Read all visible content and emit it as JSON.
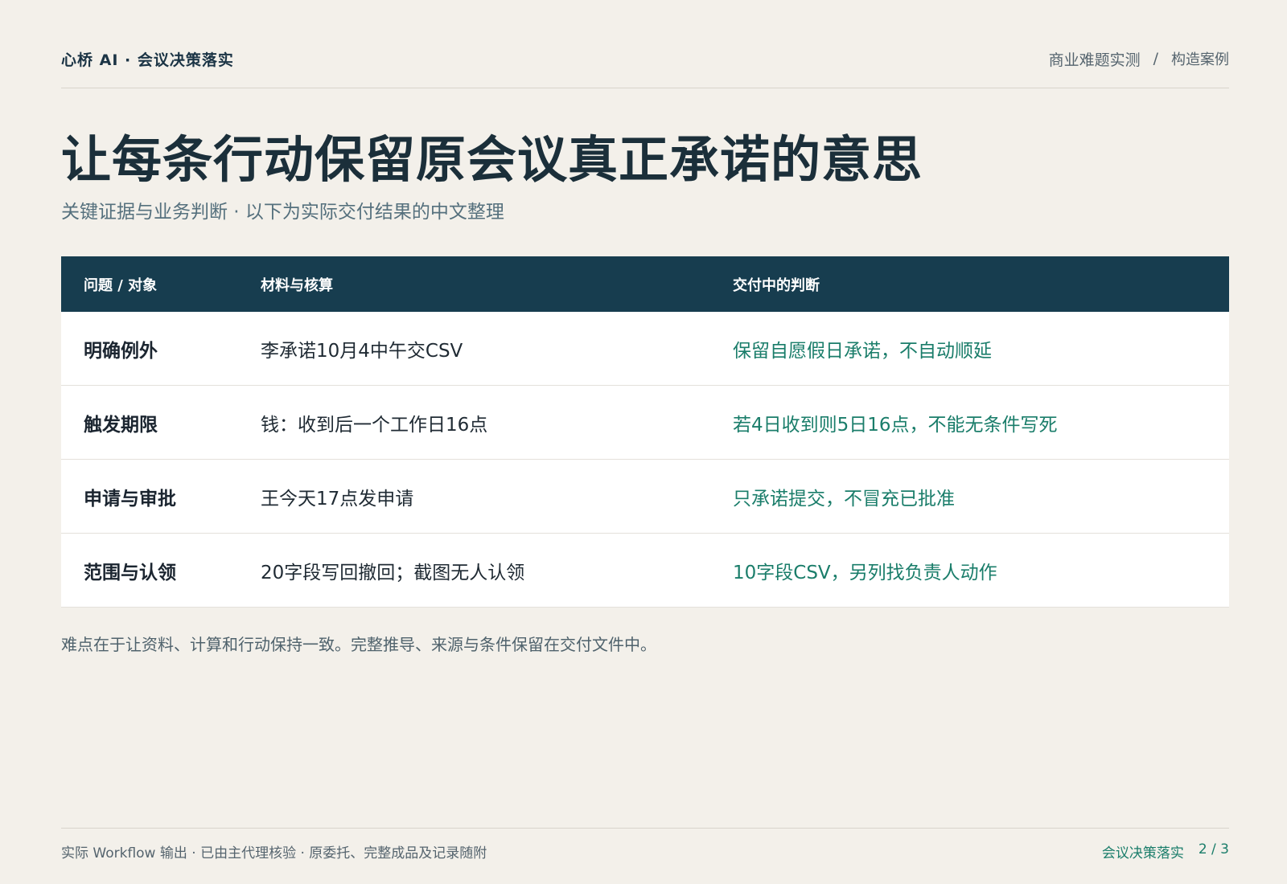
{
  "header": {
    "brand": "心桥 AI · 会议决策落实",
    "breadcrumb": [
      "商业难题实测",
      "构造案例"
    ],
    "breadcrumb_separator": "/"
  },
  "title": "让每条行动保留原会议真正承诺的意思",
  "subtitle": "关键证据与业务判断 · 以下为实际交付结果的中文整理",
  "table": {
    "columns": [
      "问题 / 对象",
      "材料与核算",
      "交付中的判断"
    ],
    "rows": [
      {
        "item": "明确例外",
        "material": "李承诺10月4中午交CSV",
        "judgment": "保留自愿假日承诺，不自动顺延"
      },
      {
        "item": "触发期限",
        "material": "钱：收到后一个工作日16点",
        "judgment": "若4日收到则5日16点，不能无条件写死"
      },
      {
        "item": "申请与审批",
        "material": "王今天17点发申请",
        "judgment": "只承诺提交，不冒充已批准"
      },
      {
        "item": "范围与认领",
        "material": "20字段写回撤回；截图无人认领",
        "judgment": "10字段CSV，另列找负责人动作"
      }
    ]
  },
  "note": "难点在于让资料、计算和行动保持一致。完整推导、来源与条件保留在交付文件中。",
  "footer": {
    "left": "实际 Workflow 输出 · 已由主代理核验 · 原委托、完整成品及记录随附",
    "section": "会议决策落实",
    "page": "2 / 3"
  },
  "colors": {
    "background": "#f3f0ea",
    "header_row": "#173d4f",
    "accent_green": "#1a7d6a",
    "title": "#1b2f3a"
  }
}
